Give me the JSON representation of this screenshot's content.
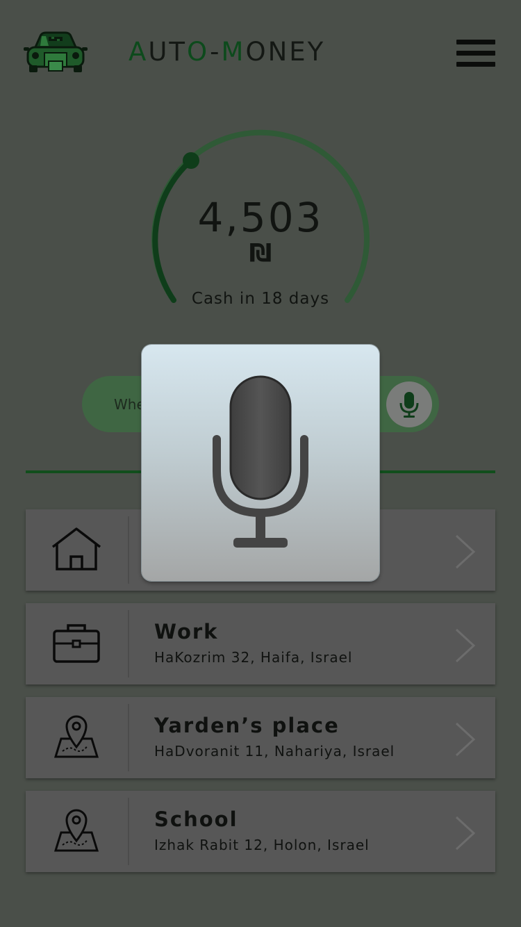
{
  "header": {
    "brand_prefix": "A",
    "brand_part1": "UT",
    "brand_o": "O",
    "brand_dash": "-",
    "brand_m": "M",
    "brand_part2": "ONEY",
    "logo_icon": "taxi-car-icon",
    "menu_icon": "hamburger-menu-icon"
  },
  "balance": {
    "amount": "4,503",
    "currency_symbol": "₪",
    "cash_label": "Cash in 18 days",
    "progress_fraction": 0.12
  },
  "search": {
    "placeholder": "Where to?",
    "mic_icon": "microphone-icon"
  },
  "places": [
    {
      "icon": "home-icon",
      "title": "",
      "address": ""
    },
    {
      "icon": "briefcase-icon",
      "title": "Work",
      "address": "HaKozrim 32, Haifa, Israel"
    },
    {
      "icon": "map-pin-icon",
      "title": "Yarden’s place",
      "address": "HaDvoranit 11, Nahariya, Israel"
    },
    {
      "icon": "map-pin-icon",
      "title": "School",
      "address": "Izhak Rabit 12, Holon, Israel"
    }
  ],
  "voice_dialog": {
    "icon": "microphone-icon"
  },
  "colors": {
    "background": "#4a4f49",
    "accent_green": "#0d4a1c",
    "search_bar": "#3f6643",
    "card": "#575757"
  }
}
